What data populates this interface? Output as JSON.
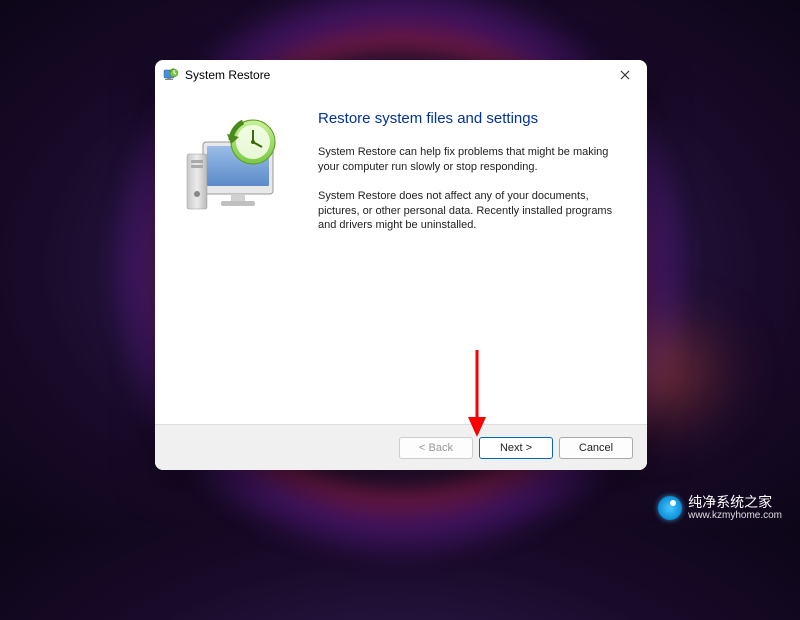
{
  "dialog": {
    "title": "System Restore",
    "heading": "Restore system files and settings",
    "paragraph1": "System Restore can help fix problems that might be making your computer run slowly or stop responding.",
    "paragraph2": "System Restore does not affect any of your documents, pictures, or other personal data. Recently installed programs and drivers might be uninstalled.",
    "buttons": {
      "back": "< Back",
      "next": "Next >",
      "cancel": "Cancel"
    }
  },
  "watermark": {
    "brand": "纯净系统之家",
    "url": "www.kzmyhome.com"
  }
}
